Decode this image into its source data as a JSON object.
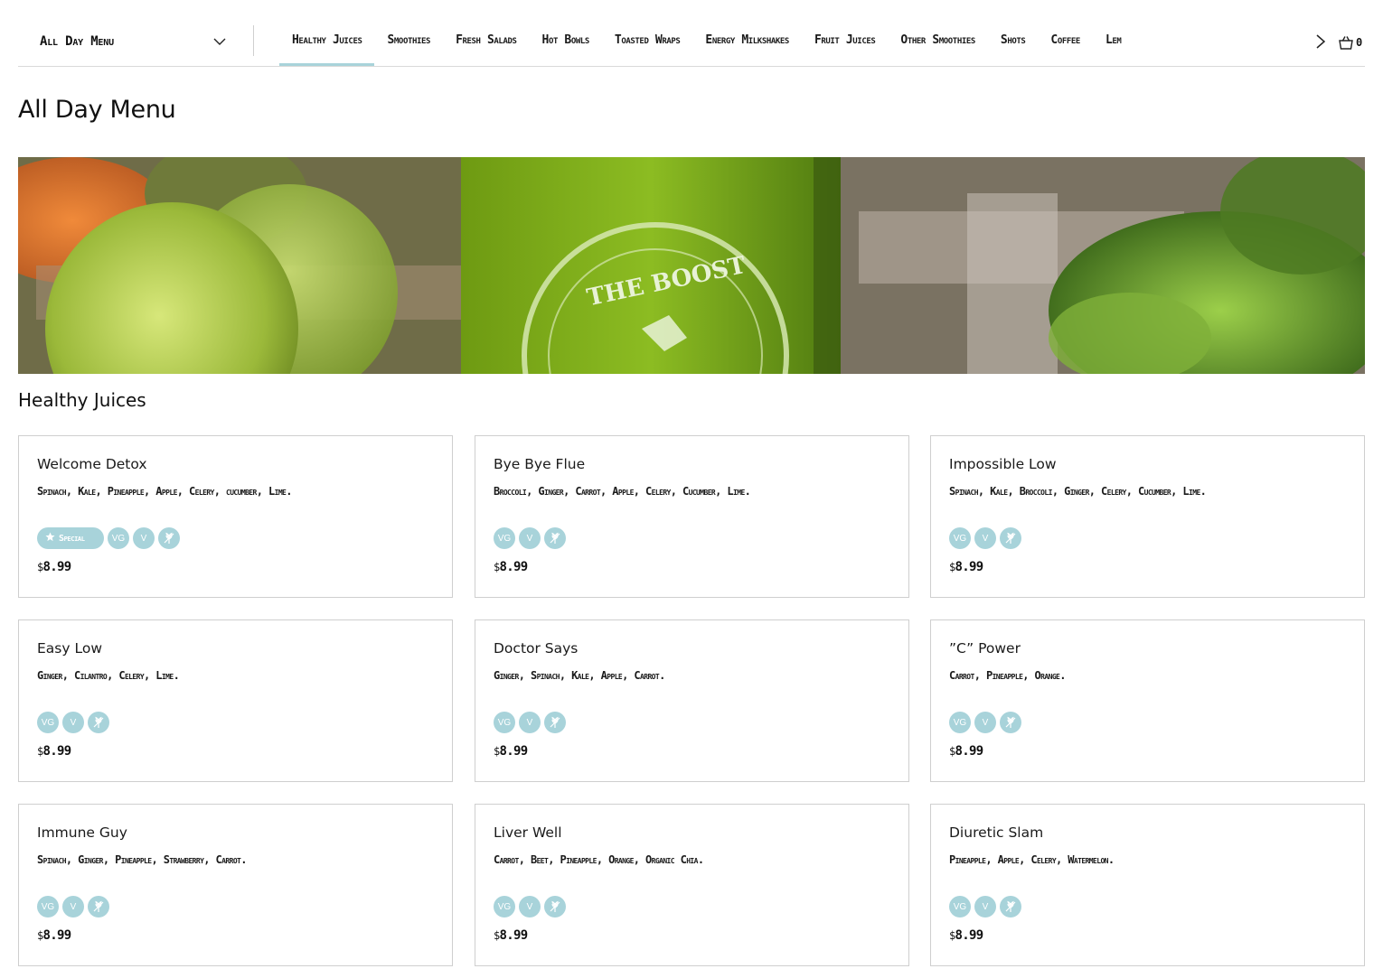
{
  "nav": {
    "menu_select": "All Day Menu",
    "tabs": [
      "Healthy Juices",
      "Smoothies",
      "Fresh Salads",
      "Hot Bowls",
      "Toasted Wraps",
      "Energy Milkshakes",
      "Fruit Juices",
      "Other Smoothies",
      "Shots",
      "Coffee",
      "Lem"
    ],
    "active_tab": "Healthy Juices",
    "cart_count": "0"
  },
  "page": {
    "title": "All Day Menu",
    "banner_logo_text": "THE BOOST",
    "section_title": "Healthy Juices"
  },
  "badges": {
    "special": "Special",
    "vegan": "VG",
    "vegetarian": "V",
    "gluten_free_icon": "gluten-free-icon"
  },
  "colors": {
    "badge": "#a8d3da",
    "active_tab_underline": "#a8d3da",
    "border": "#cfcfcf"
  },
  "items": [
    {
      "name": "Welcome Detox",
      "desc": "Spinach, Kale, Pineapple, Apple, Celery, cucumber, Lime.",
      "special": true,
      "currency": "$",
      "price": "8.99"
    },
    {
      "name": "Bye Bye Flue",
      "desc": "Broccoli, Ginger, Carrot, Apple, Celery, Cucumber, Lime.",
      "special": false,
      "currency": "$",
      "price": "8.99"
    },
    {
      "name": "Impossible Low",
      "desc": "Spinach, Kale, Broccoli, Ginger, Celery, Cucumber, Lime.",
      "special": false,
      "currency": "$",
      "price": "8.99"
    },
    {
      "name": "Easy Low",
      "desc": "Ginger, Cilantro, Celery, Lime.",
      "special": false,
      "currency": "$",
      "price": "8.99"
    },
    {
      "name": "Doctor Says",
      "desc": "Ginger, Spinach, Kale, Apple, Carrot.",
      "special": false,
      "currency": "$",
      "price": "8.99"
    },
    {
      "name": "”C” Power",
      "desc": "Carrot, Pineapple, Orange.",
      "special": false,
      "currency": "$",
      "price": "8.99"
    },
    {
      "name": "Immune Guy",
      "desc": "Spinach, Ginger, Pineapple, Strawberry, Carrot.",
      "special": false,
      "currency": "$",
      "price": "8.99"
    },
    {
      "name": "Liver Well",
      "desc": "Carrot, Beet, Pineapple, Orange, Organic Chia.",
      "special": false,
      "currency": "$",
      "price": "8.99"
    },
    {
      "name": "Diuretic Slam",
      "desc": "Pineapple, Apple, Celery, Watermelon.",
      "special": false,
      "currency": "$",
      "price": "8.99"
    }
  ]
}
